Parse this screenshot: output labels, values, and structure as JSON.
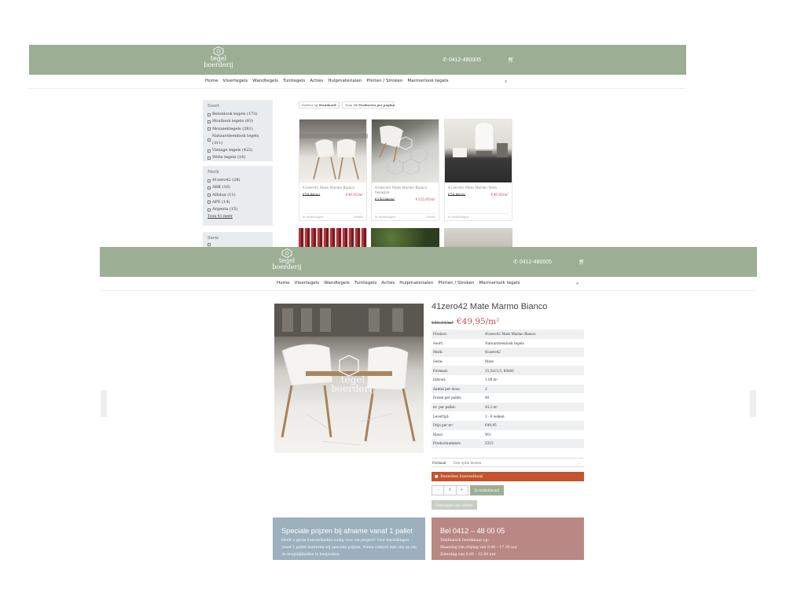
{
  "brand": {
    "logo_line1": "tegel",
    "logo_line2": "boerderij",
    "logo_badge": "nl",
    "phone": "0412-480005",
    "phone2": "0412-480005",
    "color": "#9cae94"
  },
  "nav": [
    "Home",
    "Vloertegels",
    "Wandtegels",
    "Tuintegels",
    "Acties",
    "Hulpmaterialen",
    "Plinten / Stroken",
    "Marmerlook tegels"
  ],
  "listing": {
    "filters": [
      {
        "title": "Soort",
        "items": [
          "Betonlook tegels (173)",
          "Houtlook tegels (93)",
          "Mozaiektegels (281)",
          "Natuursteenlook tegels (311)",
          "Vintage tegels (422)",
          "Witte tegels (16)"
        ],
        "more": ""
      },
      {
        "title": "Merk",
        "items": [
          "41zero42 (26)",
          "ABK (16)",
          "Alfalux (11)",
          "APE (14)",
          "Argenta (15)"
        ],
        "more": "Toon 41 meer"
      },
      {
        "title": "Serie",
        "items": [],
        "more": ""
      }
    ],
    "sort_label": "Sorteer op",
    "sort_value": "Standaard",
    "per_page_label": "Toon",
    "per_page_value": "16 Producten per pagina",
    "products": [
      {
        "name": "41zero42 Mate Marmo Bianco",
        "old": "€59,94/m²",
        "new": "€49,95/m²",
        "a1": "In winkelwagen",
        "a2": "Details"
      },
      {
        "name": "41zero42 Mate Marmo Bianco hexagon",
        "old": "€150,84/m²",
        "new": "€125,95/m²",
        "a1": "In winkelwagen",
        "a2": "Details"
      },
      {
        "name": "41zero42 Mate Marmo Nero",
        "old": "€59,94/m²",
        "new": "€49,95/m²",
        "a1": "In winkelwagen",
        "a2": ""
      }
    ]
  },
  "product": {
    "title": "41zero42 Mate Marmo Bianco",
    "old_price": "€59,94/m²",
    "new_price": "€49,95/m²",
    "specs": [
      [
        "Product:",
        "41zero42 Mate Marmo Bianco"
      ],
      [
        "Soort:",
        "Natuursteenlook tegels"
      ],
      [
        "Merk:",
        "41zero42"
      ],
      [
        "Serie:",
        "Mate"
      ],
      [
        "Formaat:",
        "15,5x15,5, 60x60"
      ],
      [
        "Inhoud:",
        "1,08 m²"
      ],
      [
        "Aantal per doos:",
        "3"
      ],
      [
        "Dozen per pallet:",
        "40"
      ],
      [
        "m² per pallet:",
        "43,2 m²"
      ],
      [
        "Levertijd:",
        "3 - 6 weken"
      ],
      [
        "Prijs per m²:",
        "€49,95"
      ],
      [
        "Kleur:",
        "Wit"
      ],
      [
        "Productnummer:",
        "5315"
      ]
    ],
    "format_label": "Formaat",
    "format_value": "Een optie kiezen",
    "stock_notice": "Bestellen hoeveelheid",
    "qty_minus": "-",
    "qty": "1",
    "qty_plus": "+",
    "add_to_cart": "In winkelmand",
    "compare": "Toevoegen aan offerte"
  },
  "promos": [
    {
      "title": "Speciale prijzen bij afname vanaf 1 pallet",
      "lines": [
        "Heeft u grote hoeveelheden nodig voor uw project? Voor bestellingen",
        "vanaf 1 pallet hanteren wij speciale prijzen. Neem contact met ons op om",
        "de mogelijkheden te bespreken."
      ],
      "color": "#9cb0be"
    },
    {
      "title": "Bel 0412 – 48 00 05",
      "lines": [
        "Telefonisch bereikbaar op:",
        "Maandag t/m vrijdag van 9.00 – 17.30 uur",
        "Zaterdag van 9.00 – 12.00 uur"
      ],
      "color": "#b98884"
    }
  ]
}
